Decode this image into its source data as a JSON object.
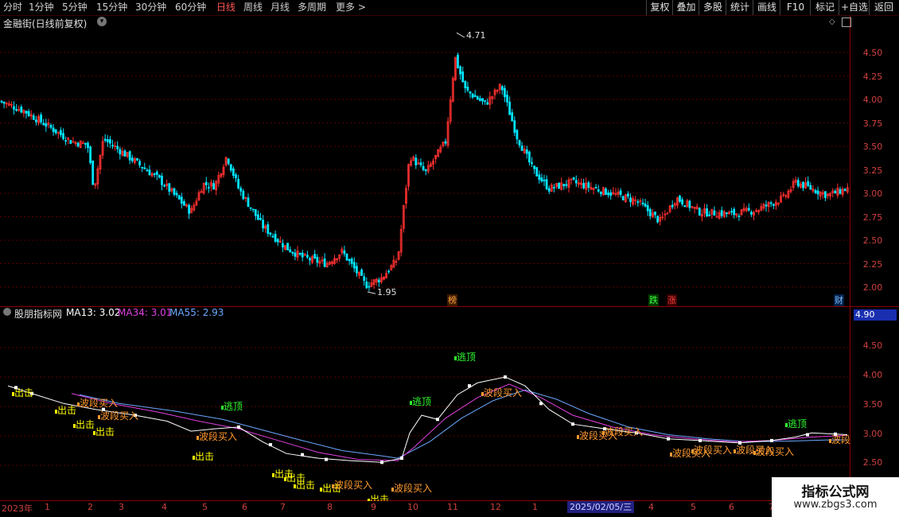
{
  "toolbar": {
    "periods": [
      "分时",
      "1分钟",
      "5分钟",
      "15分钟",
      "30分钟",
      "60分钟",
      "日线",
      "周线",
      "月线",
      "多周期",
      "更多 >"
    ],
    "active_period": "日线",
    "right_buttons": [
      "复权",
      "叠加",
      "多股",
      "统计",
      "画线",
      "F10",
      "标记",
      "+自选",
      "返回"
    ]
  },
  "main_pane": {
    "title": "金融街(日线前复权)",
    "high_label": "4.71",
    "low_label": "1.95",
    "price_ticks": [
      "4.50",
      "4.25",
      "4.00",
      "3.75",
      "3.50",
      "3.25",
      "3.00",
      "2.75",
      "2.50",
      "2.25",
      "2.00"
    ],
    "events": [
      {
        "text": "榜",
        "color": "#ffa040"
      },
      {
        "text": "跌",
        "color": "#40ff40"
      },
      {
        "text": "涨",
        "color": "#ff4040"
      },
      {
        "text": "财",
        "color": "#80c0ff"
      }
    ]
  },
  "indicator_pane": {
    "name": "股朋指标网",
    "ma13": "MA13: 3.02",
    "ma34": "MA34: 3.01",
    "ma55": "MA55: 2.93",
    "value_box": "4.90",
    "ticks": [
      "4.50",
      "4.00",
      "3.50",
      "3.00",
      "2.50"
    ],
    "signals": {
      "escape": "逃顶",
      "strike": "出击",
      "band_buy": "波段买入"
    }
  },
  "dates": {
    "year": "2023年",
    "months": [
      "1",
      "2",
      "3",
      "4",
      "5",
      "6",
      "7",
      "8",
      "9",
      "10",
      "11",
      "12",
      "1",
      "4",
      "5",
      "6",
      "7"
    ],
    "selected_date": "2025/02/05/三"
  },
  "watermark": {
    "title": "指标公式网",
    "url": "www.zbgs3.com"
  },
  "colors": {
    "up": "#ff3030",
    "down": "#00e5ff",
    "ma13": "#ffffff",
    "ma34": "#e040e0",
    "ma55": "#6aa8ff",
    "escape": "#30ff30",
    "strike": "#ffff00",
    "band_buy": "#ff9a30"
  }
}
